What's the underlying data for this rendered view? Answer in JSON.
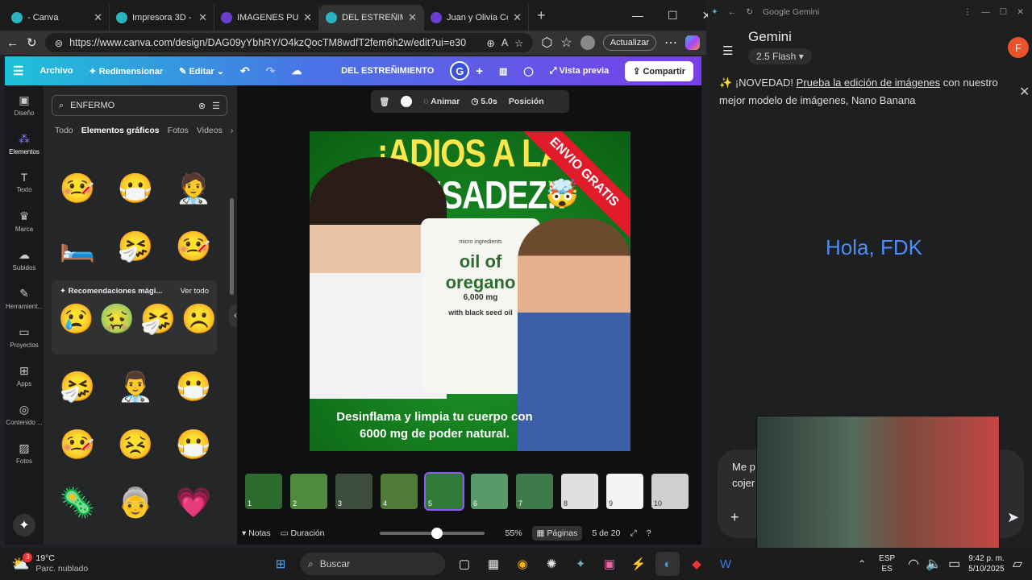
{
  "browser": {
    "tabs": [
      {
        "title": "- Canva"
      },
      {
        "title": "Impresora 3D - 10"
      },
      {
        "title": "IMAGENES PUBLI"
      },
      {
        "title": "DEL ESTREÑIMIEN"
      },
      {
        "title": "Juan y Olivia Con"
      }
    ],
    "url": "https://www.canva.com/design/DAG09yYbhRY/O4kzQocTM8wdfT2fem6h2w/edit?ui=e30",
    "update_label": "Actualizar"
  },
  "canva": {
    "toolbar": {
      "file": "Archivo",
      "resize": "Redimensionar",
      "edit": "Editar",
      "design_title": "DEL ESTREÑIMIENTO",
      "avatar": "G",
      "preview": "Vista previa",
      "share": "Compartir"
    },
    "rail": [
      {
        "label": "Diseño",
        "icon": "layout-icon"
      },
      {
        "label": "Elementos",
        "icon": "elements-icon"
      },
      {
        "label": "Texto",
        "icon": "text-icon"
      },
      {
        "label": "Marca",
        "icon": "brand-icon"
      },
      {
        "label": "Subidos",
        "icon": "upload-icon"
      },
      {
        "label": "Herramient...",
        "icon": "tools-icon"
      },
      {
        "label": "Proyectos",
        "icon": "folder-icon"
      },
      {
        "label": "Apps",
        "icon": "apps-icon"
      },
      {
        "label": "Contenido ...",
        "icon": "content-icon"
      },
      {
        "label": "Fotos",
        "icon": "photo-icon"
      }
    ],
    "search": {
      "value": "ENFERMO"
    },
    "categories": [
      "Todo",
      "Elementos gráficos",
      "Fotos",
      "Videos"
    ],
    "reco": {
      "title": "Recomendaciones mági...",
      "see_all": "Ver todo"
    },
    "element_toolbar": {
      "animate": "Animar",
      "duration": "5.0s",
      "position": "Posición"
    },
    "design": {
      "headline1": "¡ADIOS A LA",
      "headline2": "PESADEZ!!",
      "ribbon": "ENVIO GRATIS",
      "product_brand": "micro ingredients",
      "product_name1": "oil of",
      "product_name2": "oregano",
      "product_dose": "6,000 mg",
      "product_sub": "with black seed oil",
      "caption1": "Desinflama y limpia tu cuerpo con",
      "caption2": "6000 mg de poder natural."
    },
    "pages": [
      "1",
      "2",
      "3",
      "4",
      "5",
      "6",
      "7",
      "8",
      "9",
      "10"
    ],
    "bottom": {
      "notes": "Notas",
      "duration": "Duración",
      "zoom": "55%",
      "pages_label": "Páginas",
      "page_counter": "5 de 20"
    },
    "zoom_value": 0.55
  },
  "gemini": {
    "window_title": "Google Gemini",
    "app_name": "Gemini",
    "model": "2.5 Flash",
    "avatar": "F",
    "banner_prefix": "¡NOVEDAD! ",
    "banner_link": "Prueba la edición de imágenes",
    "banner_suffix": " con nuestro mejor modelo de imágenes, Nano Banana",
    "greeting": "Hola, FDK",
    "input_partial1": "Me p",
    "input_partial2": "cojer"
  },
  "taskbar": {
    "weather_temp": "19°C",
    "weather_desc": "Parc. nublado",
    "weather_badge": "3",
    "search": "Buscar",
    "lang1": "ESP",
    "lang2": "ES",
    "time": "9:42 p. m.",
    "date": "5/10/2025"
  }
}
